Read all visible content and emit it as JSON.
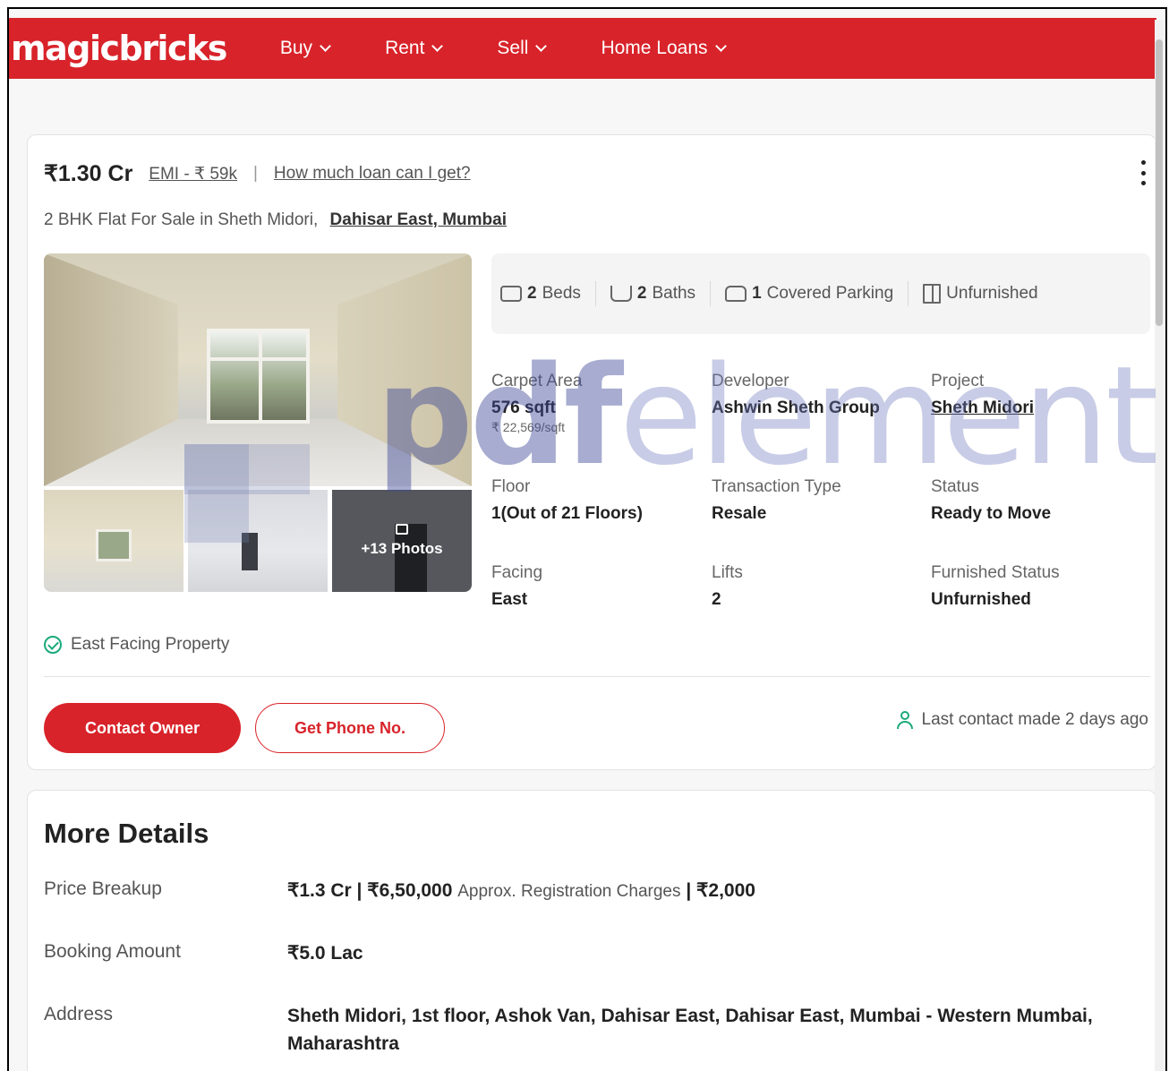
{
  "nav": {
    "logo": "magicbricks",
    "items": [
      {
        "label": "Buy"
      },
      {
        "label": "Rent"
      },
      {
        "label": "Sell"
      },
      {
        "label": "Home Loans"
      }
    ]
  },
  "listing": {
    "price": "₹1.30 Cr",
    "emi": "EMI - ₹ 59k",
    "separator": "|",
    "loan_link": "How much loan can I get?",
    "title": "2 BHK Flat For Sale in Sheth Midori,",
    "location": "Dahisar East, Mumbai",
    "photos_overlay": "+13 Photos",
    "amenities": {
      "beds_count": "2",
      "beds_label": "Beds",
      "baths_count": "2",
      "baths_label": "Baths",
      "parking_count": "1",
      "parking_label": "Covered Parking",
      "furnish_label": "Unfurnished"
    },
    "summary": {
      "carpet_area_label": "Carpet Area",
      "carpet_area_value": "576 sqft",
      "carpet_area_rate": "₹ 22,569/sqft",
      "developer_label": "Developer",
      "developer_value": "Ashwin Sheth Group",
      "project_label": "Project",
      "project_value": "Sheth Midori",
      "floor_label": "Floor",
      "floor_value": "1(Out of 21 Floors)",
      "transaction_label": "Transaction Type",
      "transaction_value": "Resale",
      "status_label": "Status",
      "status_value": "Ready to Move",
      "facing_label": "Facing",
      "facing_value": "East",
      "lifts_label": "Lifts",
      "lifts_value": "2",
      "furnished_label": "Furnished Status",
      "furnished_value": "Unfurnished"
    },
    "highlight": "East Facing Property",
    "contact_button": "Contact Owner",
    "phone_button": "Get Phone No.",
    "last_contact": "Last contact made 2 days ago"
  },
  "more_details": {
    "title": "More Details",
    "price_breakup_label": "Price Breakup",
    "price_breakup_main": "₹1.3 Cr | ₹6,50,000",
    "price_breakup_note": "Approx. Registration Charges",
    "price_breakup_extra": "| ₹2,000",
    "booking_label": "Booking Amount",
    "booking_value": "₹5.0 Lac",
    "address_label": "Address",
    "address_value": "Sheth Midori, 1st floor, Ashok Van, Dahisar East, Dahisar East, Mumbai - Western Mumbai, Maharashtra"
  },
  "watermark": {
    "text_bold": "pdf",
    "text_light": "element"
  },
  "colors": {
    "brand_red": "#d8232a",
    "success_green": "#1aa97b"
  }
}
